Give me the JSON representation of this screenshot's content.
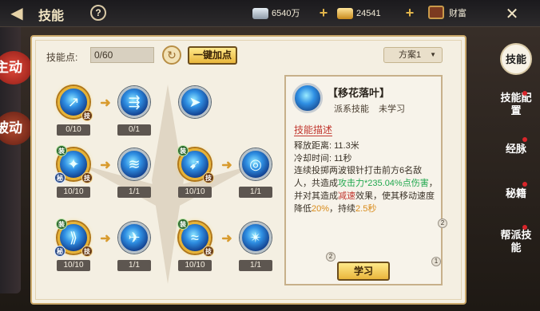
{
  "topbar": {
    "title": "技能",
    "help": "?",
    "silver": "6540万",
    "gold": "24541",
    "wealth": "财富"
  },
  "lefttabs": {
    "active": "主动",
    "passive": "被动"
  },
  "points": {
    "label": "技能点:",
    "value": "0/60"
  },
  "auto_btn": "一键加点",
  "plan": {
    "selected": "方案1"
  },
  "grid": [
    {
      "nodes": [
        {
          "count": "0/10",
          "badges": [
            "技"
          ],
          "gold": true,
          "glyph": "↗"
        },
        {
          "count": "0/1",
          "badges": [],
          "gold": false,
          "glyph": "⇶"
        },
        {
          "count": "",
          "badges": [],
          "gold": false,
          "glyph": "➤"
        }
      ]
    },
    {
      "nodes": [
        {
          "count": "10/10",
          "badges": [
            "装",
            "秘",
            "技"
          ],
          "gold": true,
          "glyph": "✦"
        },
        {
          "count": "1/1",
          "badges": [],
          "gold": false,
          "glyph": "≋"
        },
        {
          "count": "10/10",
          "badges": [
            "装",
            "技"
          ],
          "gold": true,
          "glyph": "➹"
        },
        {
          "count": "1/1",
          "badges": [],
          "gold": false,
          "glyph": "◎"
        }
      ]
    },
    {
      "nodes": [
        {
          "count": "10/10",
          "badges": [
            "装",
            "秘",
            "技"
          ],
          "gold": true,
          "glyph": "⟫"
        },
        {
          "count": "1/1",
          "badges": [],
          "gold": false,
          "glyph": "✈"
        },
        {
          "count": "10/10",
          "badges": [
            "装",
            "技"
          ],
          "gold": true,
          "glyph": "≈"
        },
        {
          "count": "1/1",
          "badges": [],
          "gold": false,
          "glyph": "✴"
        }
      ]
    }
  ],
  "detail": {
    "name": "【移花落叶】",
    "type": "派系技能",
    "status": "未学习",
    "section": "技能描述",
    "range": "释放距离: 11.3米",
    "cooldown": "冷却时间: 11秒",
    "desc_a": "连续投掷两波银针打击前方6名敌人，共造成",
    "desc_b": "攻击力*235.04%点伤害",
    "desc_c": "，并对其造成",
    "desc_d": "减速",
    "desc_e": "效果，使其移动速度降低",
    "desc_f": "20%",
    "desc_g": "，持续",
    "desc_h": "2.5秒",
    "learn": "学习",
    "pages": [
      "2",
      "2",
      "1"
    ]
  },
  "righttabs": [
    "技能",
    "技能配置",
    "经脉",
    "秘籍",
    "帮派技能"
  ],
  "colors": {
    "accent": "#e9b63c",
    "red": "#c1372f",
    "green": "#21a84e"
  }
}
